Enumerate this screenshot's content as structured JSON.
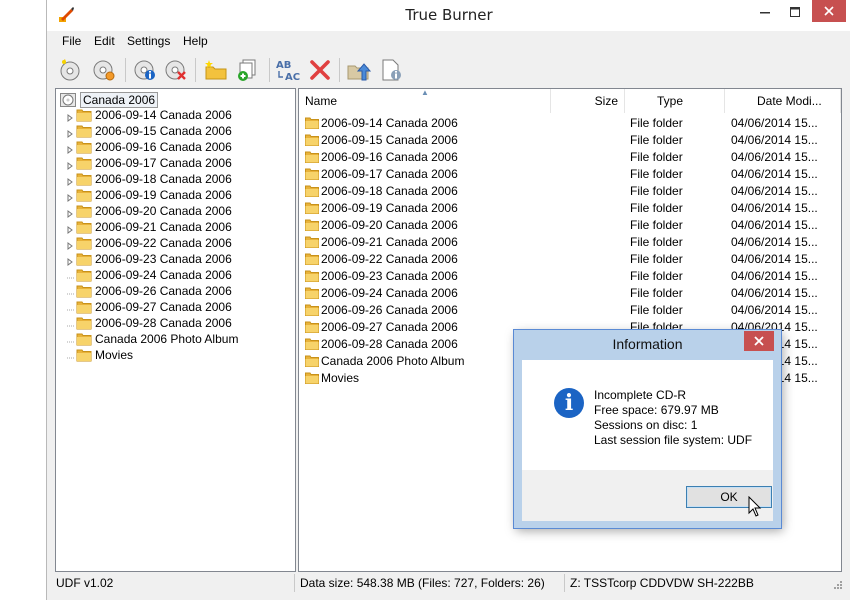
{
  "window": {
    "title": "True Burner",
    "accent": "#1b64c4"
  },
  "menu": [
    "File",
    "Edit",
    "Settings",
    "Help"
  ],
  "toolbar": {
    "icons": [
      "new-disc-icon",
      "disc-options-icon",
      "disc-info-icon",
      "erase-disc-icon",
      "new-folder-icon",
      "add-files-icon",
      "rename-icon",
      "delete-icon",
      "up-folder-icon",
      "properties-icon"
    ]
  },
  "tree": {
    "root": "Canada 2006",
    "items": [
      "2006-09-14 Canada 2006",
      "2006-09-15 Canada 2006",
      "2006-09-16 Canada 2006",
      "2006-09-17 Canada 2006",
      "2006-09-18 Canada 2006",
      "2006-09-19 Canada 2006",
      "2006-09-20 Canada 2006",
      "2006-09-21 Canada 2006",
      "2006-09-22 Canada 2006",
      "2006-09-23 Canada 2006",
      "2006-09-24 Canada 2006",
      "2006-09-26 Canada 2006",
      "2006-09-27 Canada 2006",
      "2006-09-28 Canada 2006",
      "Canada 2006 Photo Album",
      "Movies"
    ]
  },
  "list": {
    "columns": [
      "Name",
      "Size",
      "Type",
      "Date Modi..."
    ],
    "rows": [
      {
        "name": "2006-09-14 Canada 2006",
        "type": "File folder",
        "date": "04/06/2014 15..."
      },
      {
        "name": "2006-09-15 Canada 2006",
        "type": "File folder",
        "date": "04/06/2014 15..."
      },
      {
        "name": "2006-09-16 Canada 2006",
        "type": "File folder",
        "date": "04/06/2014 15..."
      },
      {
        "name": "2006-09-17 Canada 2006",
        "type": "File folder",
        "date": "04/06/2014 15..."
      },
      {
        "name": "2006-09-18 Canada 2006",
        "type": "File folder",
        "date": "04/06/2014 15..."
      },
      {
        "name": "2006-09-19 Canada 2006",
        "type": "File folder",
        "date": "04/06/2014 15..."
      },
      {
        "name": "2006-09-20 Canada 2006",
        "type": "File folder",
        "date": "04/06/2014 15..."
      },
      {
        "name": "2006-09-21 Canada 2006",
        "type": "File folder",
        "date": "04/06/2014 15..."
      },
      {
        "name": "2006-09-22 Canada 2006",
        "type": "File folder",
        "date": "04/06/2014 15..."
      },
      {
        "name": "2006-09-23 Canada 2006",
        "type": "File folder",
        "date": "04/06/2014 15..."
      },
      {
        "name": "2006-09-24 Canada 2006",
        "type": "File folder",
        "date": "04/06/2014 15..."
      },
      {
        "name": "2006-09-26 Canada 2006",
        "type": "File folder",
        "date": "04/06/2014 15..."
      },
      {
        "name": "2006-09-27 Canada 2006",
        "type": "File folder",
        "date": "04/06/2014 15..."
      },
      {
        "name": "2006-09-28 Canada 2006",
        "type": "File folder",
        "date": "04/06/2014 15..."
      },
      {
        "name": "Canada 2006 Photo Album",
        "type": "File folder",
        "date": "04/06/2014 15..."
      },
      {
        "name": "Movies",
        "type": "File folder",
        "date": "04/06/2014 15..."
      }
    ]
  },
  "status": {
    "fs": "UDF v1.02",
    "data_size": "Data size: 548.38 MB (Files: 727, Folders: 26)",
    "drive": "Z: TSSTcorp CDDVDW SH-222BB"
  },
  "dialog": {
    "title": "Information",
    "lines": [
      "Incomplete CD-R",
      "Free space: 679.97 MB",
      "Sessions on disc: 1",
      "Last session file system: UDF"
    ],
    "ok_label": "OK",
    "icon": "info-icon",
    "close_color": "#c75050"
  }
}
